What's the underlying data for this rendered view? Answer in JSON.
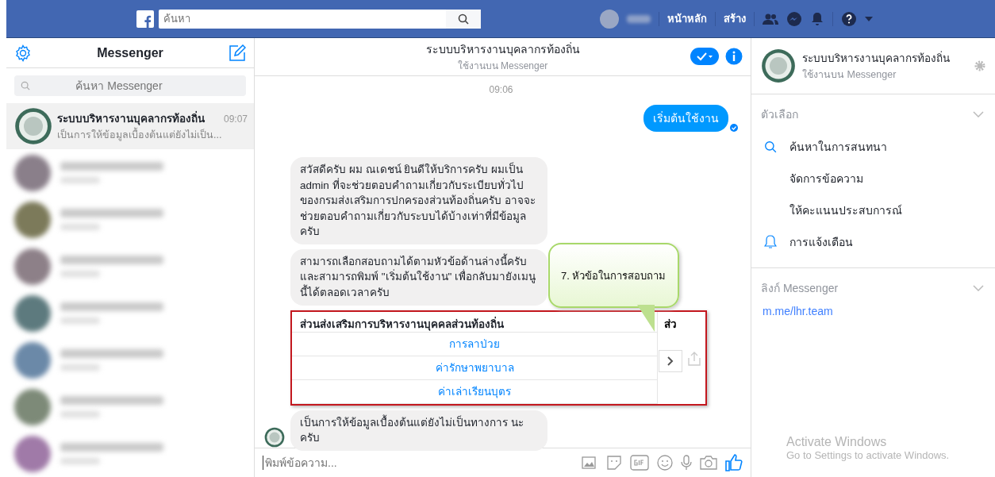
{
  "topbar": {
    "search_placeholder": "ค้นหา",
    "nav": [
      "หน้าหลัก",
      "สร้าง"
    ]
  },
  "sidebar": {
    "title": "Messenger",
    "search_placeholder": "ค้นหา Messenger",
    "conversations": [
      {
        "kind": "visible",
        "selected": true,
        "name": "ระบบบริหารงานบุคลากรท้องถิ่น",
        "time": "09:07",
        "preview": "เป็นการให้ข้อมูลเบื้องต้นแต่ยังไม่เป็น..."
      },
      {
        "kind": "blurred",
        "selected": false
      },
      {
        "kind": "blurred",
        "selected": false
      },
      {
        "kind": "blurred",
        "selected": false
      },
      {
        "kind": "blurred",
        "selected": false
      },
      {
        "kind": "blurred",
        "selected": false
      },
      {
        "kind": "blurred",
        "selected": false
      },
      {
        "kind": "blurred",
        "selected": false
      }
    ]
  },
  "chat": {
    "title": "ระบบบริหารงานบุคลากรท้องถิ่น",
    "subtitle": "ใช้งานบน Messenger",
    "messages": [
      {
        "kind": "time",
        "text": "09:06"
      },
      {
        "kind": "outgoing",
        "text": "เริ่มต้นใช้งาน"
      },
      {
        "kind": "incoming",
        "text": "สวัสดีครับ ผม ณเดชน์ ยินดีให้บริการครับ ผมเป็น admin ที่จะช่วยตอบคำถามเกี่ยวกับระเบียบทั่วไปของกรมส่งเสริมการปกครองส่วนท้องถิ่นครับ อาจจะช่วยตอบคำถามเกี่ยวกับระบบได้บ้างเท่าที่มีข้อมูลครับ"
      },
      {
        "kind": "incoming",
        "text": "สามารถเลือกสอบถามได้ตามหัวข้อด้านล่างนี้ครับ และสามารถพิมพ์ \"เริ่มต้นใช้งาน\" เพื่อกลับมายังเมนูนี้ได้ตลอดเวลาครับ"
      },
      {
        "kind": "card",
        "title": "ส่วนส่งเสริมการบริหารงานบุคคลส่วนท้องถิ่น",
        "buttons": [
          "การลาป่วย",
          "ค่ารักษาพยาบาล",
          "ค่าเล่าเรียนบุตร"
        ],
        "next_title": "ส่ว"
      },
      {
        "kind": "incoming",
        "text": "เป็นการให้ข้อมูลเบื้องต้นแต่ยังไม่เป็นทางการ นะครับ",
        "avatar": true
      }
    ],
    "composer_placeholder": "พิมพ์ข้อความ...",
    "callout": "7. หัวข้อในการสอบถาม"
  },
  "info": {
    "name": "ระบบบริหารงานบุคลากรท้องถิ่น",
    "subtitle": "ใช้งานบน Messenger",
    "options_title": "ตัวเลือก",
    "options": [
      {
        "kind": "search",
        "label": "ค้นหาในการสนทนา"
      },
      {
        "kind": "plain",
        "label": "จัดการข้อความ"
      },
      {
        "kind": "plain",
        "label": "ให้คะแนนประสบการณ์"
      },
      {
        "kind": "bell",
        "label": "การแจ้งเตือน"
      }
    ],
    "links_title": "ลิงก์ Messenger",
    "link": "m.me/lhr.team"
  },
  "os_notice": {
    "title": "Activate Windows",
    "text": "Go to Settings to activate Windows."
  }
}
